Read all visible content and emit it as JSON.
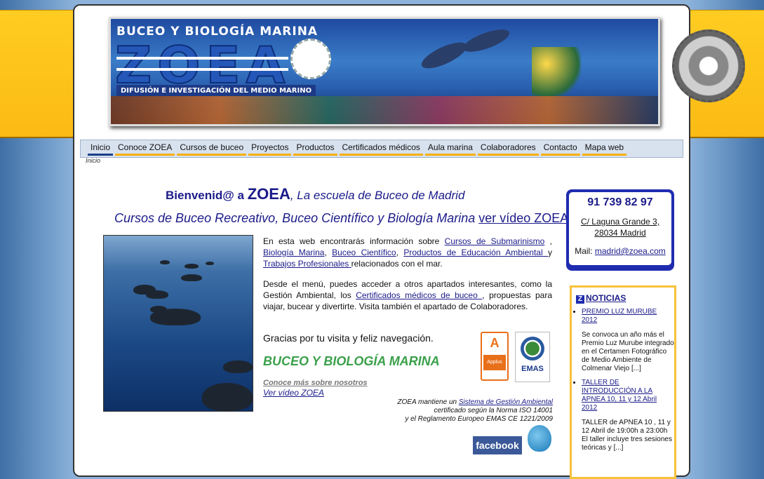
{
  "banner": {
    "title": "BUCEO Y BIOLOGÍA MARINA",
    "logo_text": "ZOEA",
    "subtitle": "DIFUSIÓN E INVESTIGACIÓN DEL MEDIO MARINO"
  },
  "nav": {
    "items": [
      "Inicio",
      "Conoce ZOEA",
      "Cursos de buceo",
      "Proyectos",
      "Productos",
      "Certificados médicos",
      "Aula marina",
      "Colaboradores",
      "Contacto",
      "Mapa web"
    ],
    "active": "Inicio"
  },
  "breadcrumb": "Inicio",
  "welcome": {
    "prefix": "Bienvenid@ a ",
    "brand": "ZOEA",
    "rest": ", La escuela de Buceo de Madrid"
  },
  "subline": {
    "text": "Cursos de Buceo Recreativo, Buceo Científico y Biología Marina ",
    "link": "ver vídeo ZOEA"
  },
  "intro": {
    "t1": "En esta web encontrarás información sobre ",
    "l1": "Cursos de Submarinismo",
    "t2": " , ",
    "l2": "Biología Marina",
    "t3": ", ",
    "l3": "Buceo Científico",
    "t4": ", ",
    "l4": "Productos de Educación Ambiental ",
    "t5": "y ",
    "l5": "Trabajos Profesionales ",
    "t6": "relacionados con el mar."
  },
  "menu_para": {
    "t1": "Desde el menú, puedes acceder a otros apartados interesantes, como la Gestión Ambiental, los ",
    "l1": "Certificados médicos de buceo ",
    "t2": ", propuestas para viajar, bucear y divertirte. Visita también el apartado de Colaboradores."
  },
  "gracias": "Gracias por tu visita y feliz navegación.",
  "slogan": "BUCEO Y BIOLOGÍA MARINA",
  "conoce_link": "Conoce más sobre nosotros",
  "video_link": "Ver vídeo ZOEA",
  "certs": {
    "applus": "Applus",
    "emas": "EMAS"
  },
  "sga": {
    "t1": "ZOEA mantiene un ",
    "link": "Sistema de Gestión Ambiental",
    "t2": "certificado según la Norma ISO 14001",
    "t3": "y el Reglamento Europeo EMAS CE 1221/2009"
  },
  "social": {
    "facebook": "facebook"
  },
  "contact": {
    "phone": "91 739 82 97",
    "addr1": "C/ Laguna Grande 3,",
    "addr2": "28034 Madrid",
    "mail_label": "Mail: ",
    "mail": "madrid@zoea.com"
  },
  "news": {
    "title": "NOTICIAS",
    "items": [
      {
        "link": "PREMIO LUZ MURUBE 2012",
        "text": "Se convoca un año más el Premio Luz Murube integrado en el Certamen Fotográfico de Medio Ambiente de Colmenar Viejo [...]"
      },
      {
        "link": "TALLER DE INTRODUCCIÓN A LA APNEA 10, 11 y 12 Abril 2012",
        "text": "TALLER de APNEA 10 , 11 y 12 Abril de 19:00h a 23:00h El taller incluye tres sesiones teóricas y [...]"
      }
    ]
  }
}
